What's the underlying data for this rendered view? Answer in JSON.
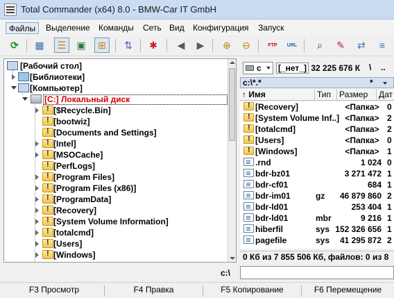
{
  "window": {
    "title": "Total Commander (x64) 8.0 - BMW-Car IT GmbH",
    "app_icon": "total-commander-icon"
  },
  "menu": [
    "Файлы",
    "Выделение",
    "Команды",
    "Сеть",
    "Вид",
    "Конфигурация",
    "Запуск"
  ],
  "toolbar": {
    "buttons": [
      "refresh",
      "brief-view",
      "full-view",
      "thumbnails-view",
      "tree-view",
      "sort-tree",
      "invert-selection",
      "back",
      "forward",
      "pack-files",
      "unpack-files",
      "ftp-connect",
      "url-connect",
      "find-files",
      "multi-rename",
      "sync-dirs"
    ],
    "ftp_label": "FTP",
    "url_label": "URL"
  },
  "tree": {
    "items": [
      {
        "label": "[Рабочий стол]",
        "level": 0,
        "expander": "none",
        "icon": "desktop-icon"
      },
      {
        "label": "[Библиотеки]",
        "level": 1,
        "expander": "closed",
        "icon": "library-icon"
      },
      {
        "label": "[Компьютер]",
        "level": 1,
        "expander": "open",
        "icon": "computer-icon"
      },
      {
        "label": "[C:]  Локальный диск",
        "level": 2,
        "expander": "open",
        "icon": "drive-icon",
        "selected": true
      },
      {
        "label": "[$Recycle.Bin]",
        "level": 3,
        "expander": "closed",
        "icon": "folder-icon"
      },
      {
        "label": "[bootwiz]",
        "level": 3,
        "expander": "none",
        "icon": "folder-icon"
      },
      {
        "label": "[Documents and Settings]",
        "level": 3,
        "expander": "none",
        "icon": "folder-icon"
      },
      {
        "label": "[Intel]",
        "level": 3,
        "expander": "closed",
        "icon": "folder-icon"
      },
      {
        "label": "[MSOCache]",
        "level": 3,
        "expander": "closed",
        "icon": "folder-icon"
      },
      {
        "label": "[PerfLogs]",
        "level": 3,
        "expander": "none",
        "icon": "folder-icon"
      },
      {
        "label": "[Program Files]",
        "level": 3,
        "expander": "closed",
        "icon": "folder-icon"
      },
      {
        "label": "[Program Files (x86)]",
        "level": 3,
        "expander": "closed",
        "icon": "folder-icon"
      },
      {
        "label": "[ProgramData]",
        "level": 3,
        "expander": "closed",
        "icon": "folder-icon"
      },
      {
        "label": "[Recovery]",
        "level": 3,
        "expander": "closed",
        "icon": "folder-icon"
      },
      {
        "label": "[System Volume Information]",
        "level": 3,
        "expander": "closed",
        "icon": "folder-icon"
      },
      {
        "label": "[totalcmd]",
        "level": 3,
        "expander": "closed",
        "icon": "folder-icon"
      },
      {
        "label": "[Users]",
        "level": 3,
        "expander": "closed",
        "icon": "folder-icon"
      },
      {
        "label": "[Windows]",
        "level": 3,
        "expander": "closed",
        "icon": "folder-icon"
      }
    ]
  },
  "right_panel": {
    "drive": "c",
    "drive_label": "[_нет_]",
    "free_space": "32 225 676 К",
    "root_button": "\\",
    "up_button": "..",
    "path": "c:\\*.*",
    "filter": "*",
    "columns": [
      "Имя",
      "Тип",
      "Размер",
      "Дат"
    ],
    "sort_indicator": "↑",
    "files": [
      {
        "name": "[Recovery]",
        "ext": "",
        "size": "<Папка>",
        "date": "0",
        "icon": "folder-icon",
        "dir": true
      },
      {
        "name": "[System Volume Inf..]",
        "ext": "",
        "size": "<Папка>",
        "date": "2",
        "icon": "folder-icon",
        "dir": true
      },
      {
        "name": "[totalcmd]",
        "ext": "",
        "size": "<Папка>",
        "date": "2",
        "icon": "folder-icon",
        "dir": true
      },
      {
        "name": "[Users]",
        "ext": "",
        "size": "<Папка>",
        "date": "0",
        "icon": "folder-icon",
        "dir": true
      },
      {
        "name": "[Windows]",
        "ext": "",
        "size": "<Папка>",
        "date": "1",
        "icon": "folder-icon",
        "dir": true
      },
      {
        "name": ".rnd",
        "ext": "",
        "size": "1 024",
        "date": "0",
        "icon": "file-icon",
        "dir": false
      },
      {
        "name": "bdr-bz01",
        "ext": "",
        "size": "3 271 472",
        "date": "1",
        "icon": "file-icon",
        "dir": false
      },
      {
        "name": "bdr-cf01",
        "ext": "",
        "size": "684",
        "date": "1",
        "icon": "file-icon",
        "dir": false
      },
      {
        "name": "bdr-im01",
        "ext": "gz",
        "size": "46 879 860",
        "date": "2",
        "icon": "file-icon",
        "dir": false
      },
      {
        "name": "bdr-ld01",
        "ext": "",
        "size": "253 404",
        "date": "1",
        "icon": "file-icon",
        "dir": false
      },
      {
        "name": "bdr-ld01",
        "ext": "mbr",
        "size": "9 216",
        "date": "1",
        "icon": "file-icon",
        "dir": false
      },
      {
        "name": "hiberfil",
        "ext": "sys",
        "size": "152 326 656",
        "date": "1",
        "icon": "file-icon",
        "dir": false
      },
      {
        "name": "pagefile",
        "ext": "sys",
        "size": "41 295 872",
        "date": "2",
        "icon": "file-icon",
        "dir": false
      }
    ],
    "status": "0 Кб из 7 855 506 Кб, файлов: 0 из 8"
  },
  "command_line": {
    "label": "c:\\",
    "value": ""
  },
  "fkeys": [
    "F3 Просмотр",
    "F4 Правка",
    "F5 Копирование",
    "F6 Перемещение"
  ],
  "colors": {
    "title_bg": "#c9dcf2",
    "path_bg": "#d5e1f1",
    "selected_drive_text": "#d40000",
    "folder": "#f3c54e"
  }
}
